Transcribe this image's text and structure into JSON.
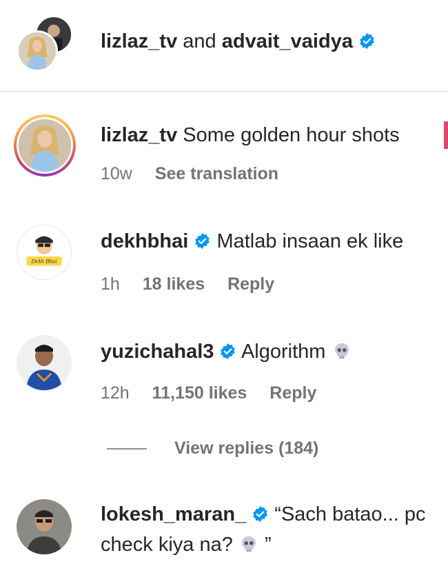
{
  "header": {
    "user1": "lizlaz_tv",
    "connector": "and",
    "user2": "advait_vaidya"
  },
  "post": {
    "username": "lizlaz_tv",
    "caption": "Some golden hour shots",
    "time": "10w",
    "see_translation": "See translation"
  },
  "comments": [
    {
      "username": "dekhbhai",
      "verified": true,
      "text": "Matlab insaan ek like",
      "time": "1h",
      "likes": "18 likes",
      "reply": "Reply",
      "avatar_text": "Dekh Bhai"
    },
    {
      "username": "yuzichahal3",
      "verified": true,
      "text": "Algorithm",
      "emoji": "skull",
      "time": "12h",
      "likes": "11,150 likes",
      "reply": "Reply"
    },
    {
      "username": "lokesh_maran_",
      "verified": true,
      "text": "“Sach batao... pc",
      "text2": "check kiya na?",
      "text2_end": "”"
    }
  ],
  "view_replies": "View replies (184)",
  "colors": {
    "verified": "#0095f6",
    "meta": "#737373",
    "divider": "#dbdbdb"
  }
}
